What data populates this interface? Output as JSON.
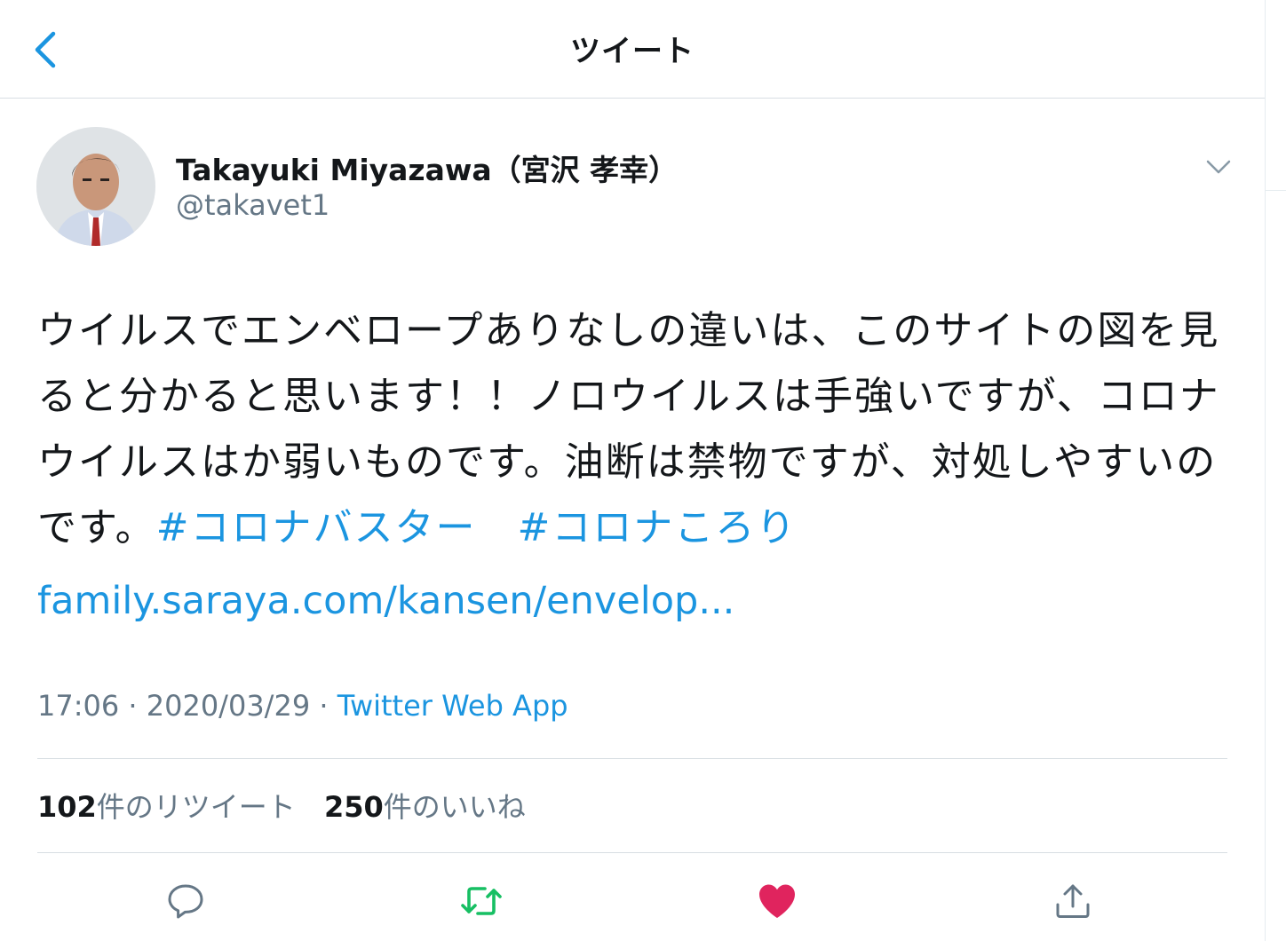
{
  "header": {
    "title": "ツイート"
  },
  "author": {
    "display_name": "Takayuki Miyazawa（宮沢 孝幸）",
    "handle": "@takavet1"
  },
  "tweet": {
    "text": "ウイルスでエンベロープありなしの違いは、このサイトの図を見ると分かると思います！！ノロウイルスは手強いですが、コロナウイルスはか弱いものです。油断は禁物ですが、対処しやすいのです。",
    "hashtags": [
      "#コロナバスター",
      "#コロナころり"
    ],
    "link": "family.saraya.com/kansen/envelop..."
  },
  "meta": {
    "time": "17:06",
    "date": "2020/03/29",
    "separator": " · ",
    "source": "Twitter Web App"
  },
  "stats": {
    "retweets_count": "102",
    "retweets_label": "件のリツイート",
    "likes_count": "250",
    "likes_label": "件のいいね"
  },
  "colors": {
    "link": "#1b95e0",
    "retweet": "#17bf63",
    "like": "#e0245e",
    "secondary_text": "#657786"
  },
  "icons": {
    "back": "chevron-left-icon",
    "menu": "chevron-down-icon",
    "reply": "reply-icon",
    "retweet": "retweet-icon",
    "like": "heart-icon",
    "share": "share-icon"
  }
}
